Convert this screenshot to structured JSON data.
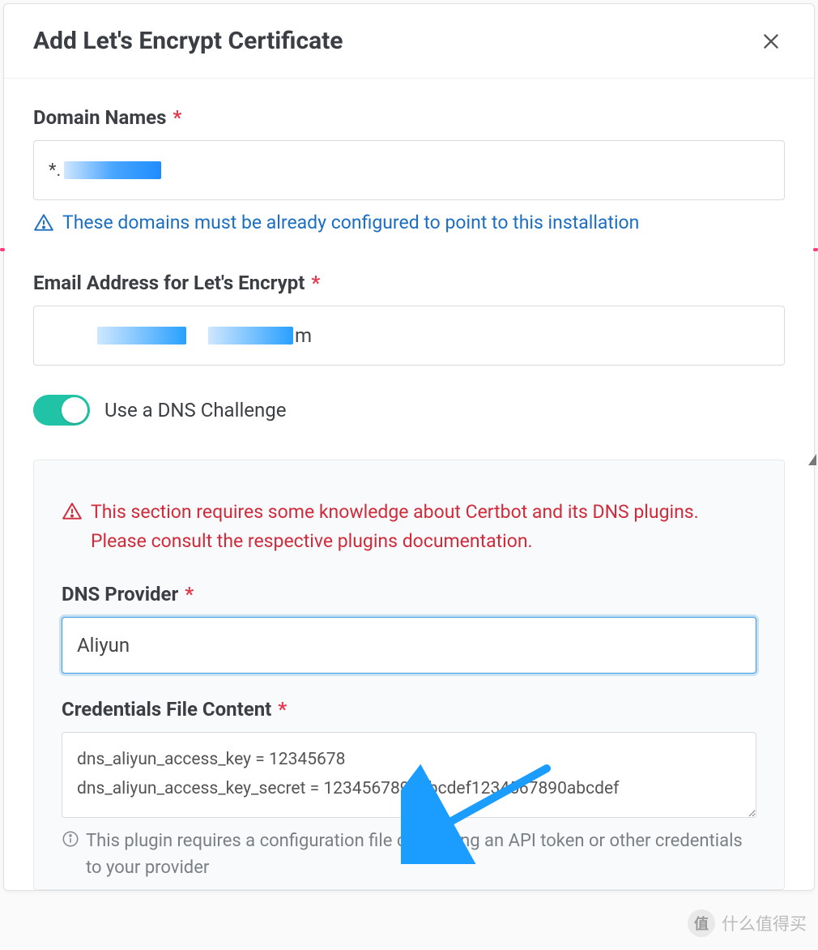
{
  "modal": {
    "title": "Add Let's Encrypt Certificate"
  },
  "domain": {
    "label": "Domain Names",
    "chip_prefix": "*.",
    "hint": "These domains must be already configured to point to this installation"
  },
  "email": {
    "label": "Email Address for Let's Encrypt",
    "suffix": "m"
  },
  "dns_toggle": {
    "label": "Use a DNS Challenge"
  },
  "dns_panel": {
    "warning": "This section requires some knowledge about Certbot and its DNS plugins. Please consult the respective plugins documentation.",
    "provider_label": "DNS Provider",
    "provider_value": "Aliyun",
    "credentials_label": "Credentials File Content",
    "credentials_value": "dns_aliyun_access_key = 12345678\ndns_aliyun_access_key_secret = 1234567890abcdef1234567890abcdef",
    "credentials_hint": "This plugin requires a configuration file containing an API token or other credentials to your provider"
  },
  "watermark": {
    "badge": "值",
    "text": "什么值得买"
  }
}
